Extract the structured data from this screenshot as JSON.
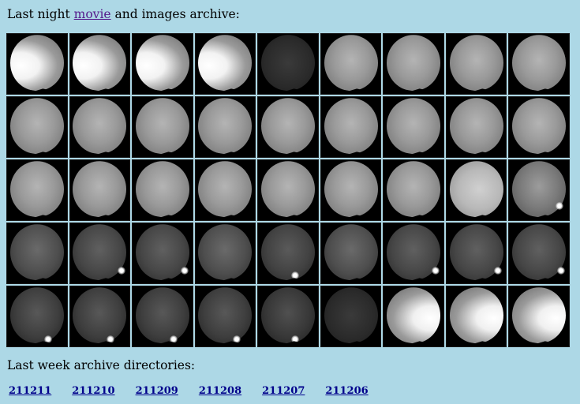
{
  "heading": {
    "prefix": "Last night ",
    "movie_link": "movie",
    "suffix": " and images archive:"
  },
  "thumbnails": [
    {
      "type": "bright-left"
    },
    {
      "type": "bright-left"
    },
    {
      "type": "bright-left"
    },
    {
      "type": "bright-left"
    },
    {
      "type": "dark"
    },
    {
      "type": "mid"
    },
    {
      "type": "mid"
    },
    {
      "type": "mid"
    },
    {
      "type": "mid"
    },
    {
      "type": "mid"
    },
    {
      "type": "mid"
    },
    {
      "type": "mid"
    },
    {
      "type": "mid"
    },
    {
      "type": "mid"
    },
    {
      "type": "mid"
    },
    {
      "type": "mid"
    },
    {
      "type": "mid"
    },
    {
      "type": "mid"
    },
    {
      "type": "mid"
    },
    {
      "type": "mid"
    },
    {
      "type": "mid"
    },
    {
      "type": "mid"
    },
    {
      "type": "mid"
    },
    {
      "type": "mid"
    },
    {
      "type": "mid"
    },
    {
      "type": "bright-mid"
    },
    {
      "type": "mid-moon-br"
    },
    {
      "type": "dim"
    },
    {
      "type": "dim-moon-br"
    },
    {
      "type": "dim-moon-br"
    },
    {
      "type": "dim"
    },
    {
      "type": "dim-moon-b"
    },
    {
      "type": "dim"
    },
    {
      "type": "dim-moon-br"
    },
    {
      "type": "dim-moon-br"
    },
    {
      "type": "dim-moon-br"
    },
    {
      "type": "dark-moon-bl"
    },
    {
      "type": "dark-moon-bl"
    },
    {
      "type": "dark-moon-bl"
    },
    {
      "type": "dark-moon-bl"
    },
    {
      "type": "dark-moon-b"
    },
    {
      "type": "dark"
    },
    {
      "type": "bright-right"
    },
    {
      "type": "bright-right"
    },
    {
      "type": "bright-right"
    }
  ],
  "week_heading": "Last week archive directories:",
  "directories": [
    "211211",
    "211210",
    "211209",
    "211208",
    "211207",
    "211206"
  ]
}
